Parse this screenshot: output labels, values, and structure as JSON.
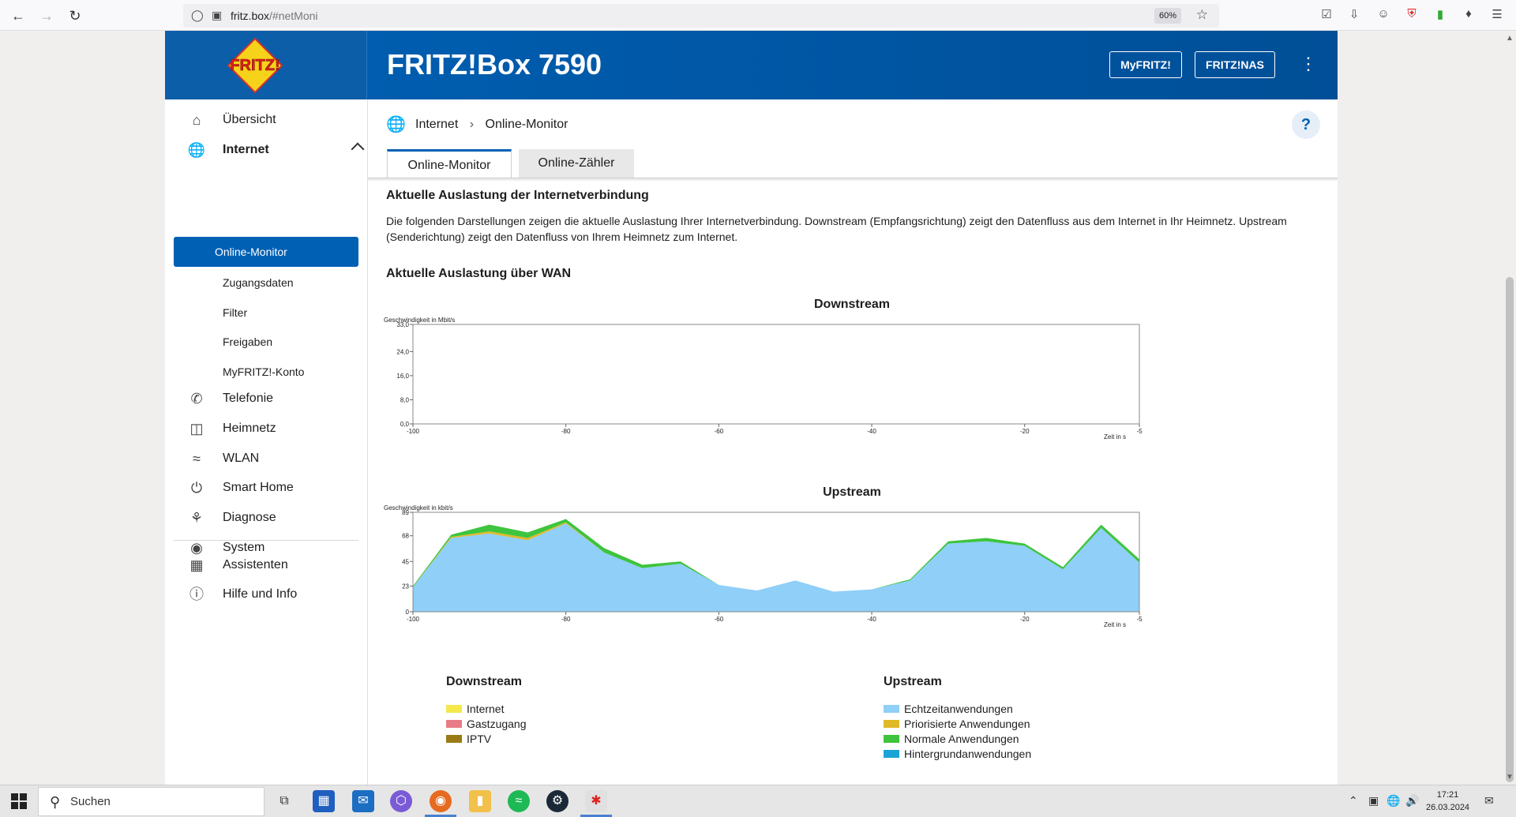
{
  "browser": {
    "url_host": "fritz.box",
    "url_path": "/#netMoni",
    "zoom": "60%"
  },
  "header": {
    "logo_text": "FRITZ!",
    "title": "FRITZ!Box 7590",
    "btn_myfritz": "MyFRITZ!",
    "btn_fritznas": "FRITZ!NAS"
  },
  "sidebar": {
    "items": [
      {
        "label": "Übersicht",
        "icon": "home-icon"
      },
      {
        "label": "Internet",
        "icon": "globe-icon"
      },
      {
        "label": "Telefonie",
        "icon": "phone-icon"
      },
      {
        "label": "Heimnetz",
        "icon": "network-icon"
      },
      {
        "label": "WLAN",
        "icon": "wifi-icon"
      },
      {
        "label": "Smart Home",
        "icon": "smart-home-icon"
      },
      {
        "label": "Diagnose",
        "icon": "diagnose-icon"
      },
      {
        "label": "System",
        "icon": "system-icon"
      },
      {
        "label": "Assistenten",
        "icon": "assistant-icon"
      },
      {
        "label": "Hilfe und Info",
        "icon": "help-icon"
      }
    ],
    "sub_items": [
      "Online-Monitor",
      "Zugangsdaten",
      "Filter",
      "Freigaben",
      "MyFRITZ!-Konto"
    ]
  },
  "breadcrumb": {
    "parent": "Internet",
    "current": "Online-Monitor"
  },
  "tabs": [
    "Online-Monitor",
    "Online-Zähler"
  ],
  "content": {
    "heading": "Aktuelle Auslastung der Internetverbindung",
    "paragraph": "Die folgenden Darstellungen zeigen die aktuelle Auslastung Ihrer Internetverbindung. Downstream (Empfangsrichtung) zeigt den Datenfluss aus dem Internet in Ihr Heimnetz. Upstream (Senderichtung) zeigt den Datenfluss von Ihrem Heimnetz zum Internet.",
    "wan_heading": "Aktuelle Auslastung über WAN"
  },
  "chart_data": [
    {
      "type": "area",
      "title": "Downstream",
      "ylabel": "Geschwindigkeit in Mbit/s",
      "xlabel": "Zeit in s",
      "ylim": [
        0,
        33.0
      ],
      "y_ticks": [
        "0,0",
        "8,0",
        "16,0",
        "24,0",
        "33,0"
      ],
      "y_tick_values": [
        0,
        8,
        16,
        24,
        33
      ],
      "x_ticks": [
        "-100",
        "-80",
        "-60",
        "-40",
        "-20",
        "-5"
      ],
      "x_tick_values": [
        -100,
        -80,
        -60,
        -40,
        -20,
        -5
      ],
      "xlim": [
        -100,
        -5
      ],
      "series": []
    },
    {
      "type": "area",
      "title": "Upstream",
      "ylabel": "Geschwindigkeit in kbit/s",
      "xlabel": "Zeit in s",
      "ylim": [
        0,
        89
      ],
      "y_ticks": [
        "0",
        "23",
        "45",
        "68",
        "89"
      ],
      "y_tick_values": [
        0,
        23,
        45,
        68,
        89
      ],
      "x_ticks": [
        "-100",
        "-80",
        "-60",
        "-40",
        "-20",
        "-5"
      ],
      "x_tick_values": [
        -100,
        -80,
        -60,
        -40,
        -20,
        -5
      ],
      "xlim": [
        -100,
        -5
      ],
      "x": [
        -100,
        -95,
        -90,
        -85,
        -80,
        -75,
        -70,
        -65,
        -60,
        -55,
        -50,
        -45,
        -40,
        -35,
        -30,
        -25,
        -20,
        -15,
        -10,
        -5
      ],
      "series": [
        {
          "name": "Echtzeitanwendungen",
          "color": "#8fcff8",
          "values": [
            22,
            66,
            70,
            64,
            79,
            53,
            39,
            43,
            24,
            19,
            28,
            18,
            20,
            28,
            61,
            63,
            59,
            38,
            75,
            44
          ]
        },
        {
          "name": "Priorisierte Anwendungen",
          "color": "#e0b928",
          "values": [
            0,
            1,
            2,
            2,
            1,
            0,
            0,
            0,
            0,
            0,
            0,
            0,
            0,
            0,
            0,
            0,
            0,
            0,
            0,
            0
          ]
        },
        {
          "name": "Normale Anwendungen",
          "color": "#3ec43e",
          "values": [
            1,
            2,
            6,
            5,
            3,
            4,
            3,
            2,
            0,
            0,
            0,
            0,
            0,
            1,
            2,
            3,
            2,
            2,
            3,
            3
          ]
        },
        {
          "name": "Hintergrundanwendungen",
          "color": "#1aa3d6",
          "values": [
            0,
            0,
            0,
            0,
            0,
            0,
            0,
            0,
            0,
            0,
            0,
            0,
            0,
            0,
            0,
            0,
            0,
            0,
            0,
            0
          ]
        }
      ]
    }
  ],
  "legend": {
    "downstream_title": "Downstream",
    "downstream": [
      {
        "label": "Internet",
        "color": "#f5e84a"
      },
      {
        "label": "Gastzugang",
        "color": "#e87c86"
      },
      {
        "label": "IPTV",
        "color": "#9a7a14"
      }
    ],
    "upstream_title": "Upstream",
    "upstream": [
      {
        "label": "Echtzeitanwendungen",
        "color": "#8fcff8"
      },
      {
        "label": "Priorisierte Anwendungen",
        "color": "#e0b928"
      },
      {
        "label": "Normale Anwendungen",
        "color": "#3ec43e"
      },
      {
        "label": "Hintergrundanwendungen",
        "color": "#1aa3d6"
      }
    ]
  },
  "taskbar": {
    "search_placeholder": "Suchen",
    "time": "17:21",
    "date": "26.03.2024"
  }
}
